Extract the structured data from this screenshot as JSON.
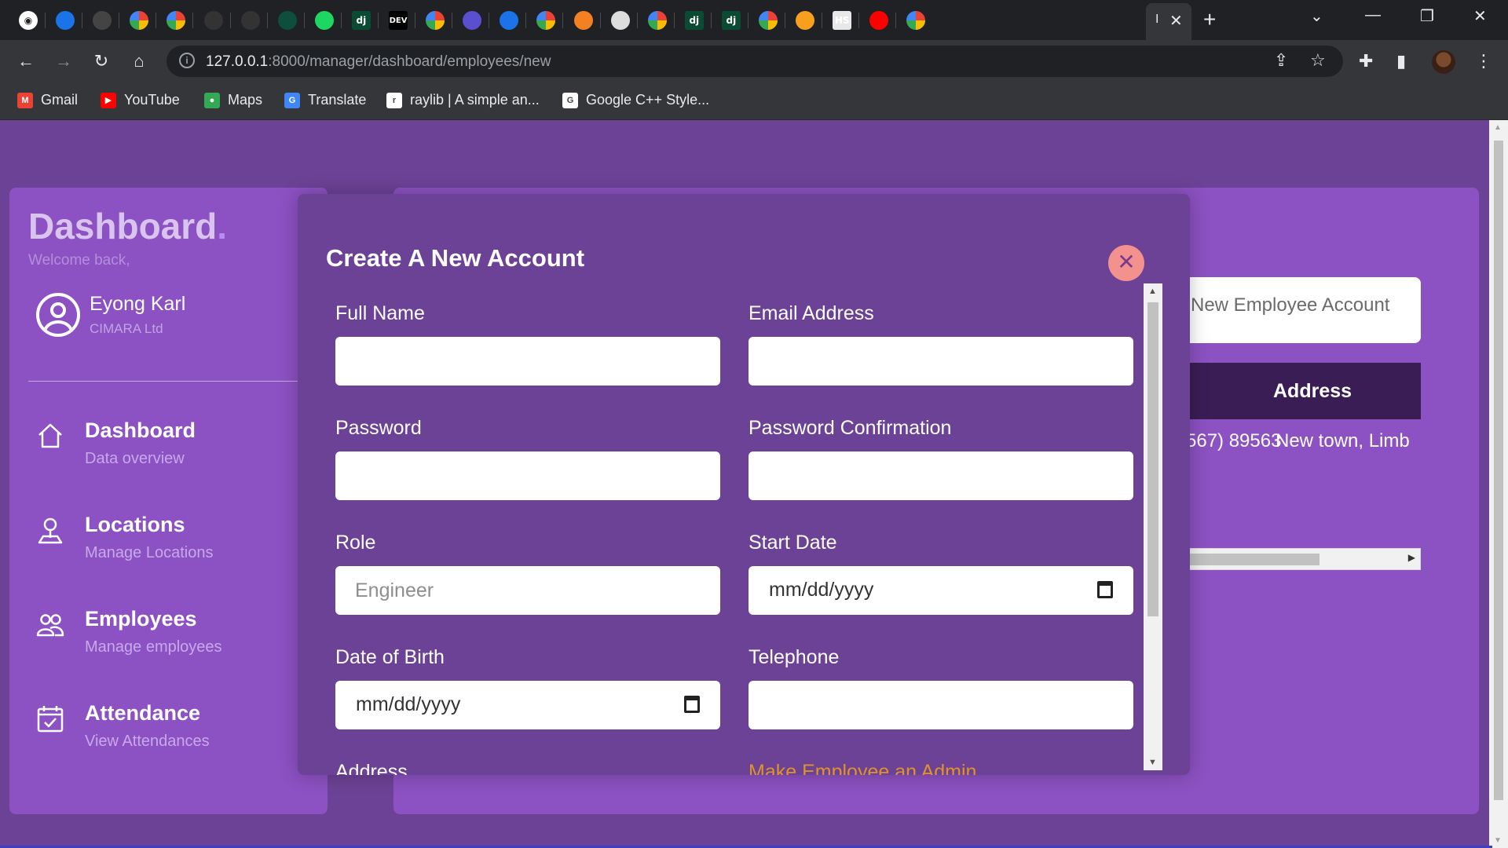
{
  "browser": {
    "tabs": [
      {
        "icon": "github-icon",
        "color": "#ffffff"
      },
      {
        "icon": "app-icon",
        "color": "#1a73e8"
      },
      {
        "icon": "app-icon",
        "color": "#444444"
      },
      {
        "icon": "google-icon",
        "color": "#ffffff"
      },
      {
        "icon": "google-icon",
        "color": "#ffffff"
      },
      {
        "icon": "app-icon",
        "color": "#333333"
      },
      {
        "icon": "app-icon",
        "color": "#333333"
      },
      {
        "icon": "app-icon",
        "color": "#0d4f3c"
      },
      {
        "icon": "play-icon",
        "color": "#1ed760"
      },
      {
        "icon": "django-icon",
        "color": "#0c4b33",
        "text": "dj"
      },
      {
        "icon": "dev-icon",
        "color": "#000000",
        "text": "DEV"
      },
      {
        "icon": "google-icon",
        "color": "#ffffff"
      },
      {
        "icon": "terminal-icon",
        "color": "#5a4fcf"
      },
      {
        "icon": "app-icon",
        "color": "#1a73e8"
      },
      {
        "icon": "google-icon",
        "color": "#ffffff"
      },
      {
        "icon": "stackoverflow-icon",
        "color": "#f48024"
      },
      {
        "icon": "globe-icon",
        "color": "#dddddd"
      },
      {
        "icon": "google-icon",
        "color": "#ffffff"
      },
      {
        "icon": "django-icon",
        "color": "#0c4b33",
        "text": "dj"
      },
      {
        "icon": "django-icon",
        "color": "#0c4b33",
        "text": "dj"
      },
      {
        "icon": "google-icon",
        "color": "#ffffff"
      },
      {
        "icon": "bolt-icon",
        "color": "#f8a01d"
      },
      {
        "icon": "hs-icon",
        "color": "#e8e8e8",
        "text": "HS"
      },
      {
        "icon": "youtube-icon",
        "color": "#ff0000"
      },
      {
        "icon": "chrome-icon",
        "color": "#ffffff"
      }
    ],
    "active_tab_title": "I",
    "url_host": "127.0.0.1",
    "url_path": ":8000/manager/dashboard/employees/new",
    "bookmarks": [
      {
        "label": "Gmail",
        "icon": "gmail-icon",
        "color": "#ea4335",
        "glyph": "M"
      },
      {
        "label": "YouTube",
        "icon": "youtube-icon",
        "color": "#ff0000",
        "glyph": "▶"
      },
      {
        "label": "Maps",
        "icon": "maps-icon",
        "color": "#34a853",
        "glyph": "●"
      },
      {
        "label": "Translate",
        "icon": "translate-icon",
        "color": "#4285f4",
        "glyph": "G"
      },
      {
        "label": "raylib | A simple an...",
        "icon": "raylib-icon",
        "color": "#ffffff",
        "glyph": "r"
      },
      {
        "label": "Google C++ Style...",
        "icon": "google-icon",
        "color": "#ffffff",
        "glyph": "G"
      }
    ]
  },
  "sidebar": {
    "brand": "Dashboard",
    "brand_dot": ".",
    "welcome": "Welcome back,",
    "user_name": "Eyong Karl",
    "user_company": "CIMARA Ltd",
    "nav": [
      {
        "title": "Dashboard",
        "subtitle": "Data overview",
        "icon": "home-icon"
      },
      {
        "title": "Locations",
        "subtitle": "Manage Locations",
        "icon": "location-pin-icon"
      },
      {
        "title": "Employees",
        "subtitle": "Manage employees",
        "icon": "users-icon"
      },
      {
        "title": "Attendance",
        "subtitle": "View Attendances",
        "icon": "calendar-check-icon"
      }
    ]
  },
  "content": {
    "new_employee_button": "New Employee Account",
    "table_header_address": "Address",
    "row_phone": "567) 89563",
    "row_address": "New town, Limb"
  },
  "modal": {
    "title": "Create A New Account",
    "fields": {
      "full_name": {
        "label": "Full Name",
        "value": "",
        "placeholder": ""
      },
      "email": {
        "label": "Email Address",
        "value": "",
        "placeholder": ""
      },
      "password": {
        "label": "Password",
        "value": "",
        "placeholder": ""
      },
      "password_confirmation": {
        "label": "Password Confirmation",
        "value": "",
        "placeholder": ""
      },
      "role": {
        "label": "Role",
        "value": "",
        "placeholder": "Engineer"
      },
      "start_date": {
        "label": "Start Date",
        "value": "mm/dd/yyyy"
      },
      "date_of_birth": {
        "label": "Date of Birth",
        "value": "mm/dd/yyyy"
      },
      "telephone": {
        "label": "Telephone",
        "value": "",
        "placeholder": ""
      }
    },
    "cut_off_labels": [
      {
        "text": "Address",
        "color": "#ffffff"
      },
      {
        "text": "Make Employee an Admin",
        "color": "#e0922a"
      }
    ]
  }
}
